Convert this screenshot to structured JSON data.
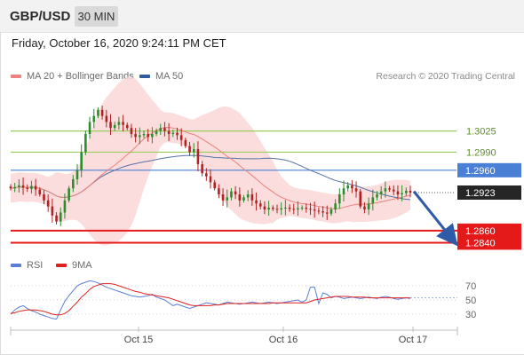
{
  "header": {
    "symbol": "GBP/USD",
    "timeframe": "30 MIN"
  },
  "datetime": "Friday, October 16, 2020 9:24:11 PM CET",
  "legend": {
    "ma20_label": "MA 20 + Bollinger Bands",
    "ma50_label": "MA 50",
    "rsi_label": "RSI",
    "rsi_ma_label": "9MA"
  },
  "research": "Research © 2020 Trading Central",
  "colors": {
    "up": "#2e8b2e",
    "down": "#b22222",
    "bb_fill": "#fbd7d7",
    "ma20": "#e9827a",
    "ma50": "#5572a6",
    "green_level": "#9acd5a",
    "blue_level": "#4a7fd6",
    "red_level": "#e41a1a",
    "current": "#222222",
    "rsi": "#5b7fd6",
    "rsi_ma": "#e02020",
    "arrow": "#2e5aa8"
  },
  "chart_data": [
    {
      "type": "candlestick",
      "title": "GBP/USD",
      "x_tick_labels": [
        "Oct 15",
        "Oct 16",
        "Oct 17"
      ],
      "levels": [
        {
          "label": "1.3025",
          "value": 1.3025,
          "kind": "resistance",
          "color": "green"
        },
        {
          "label": "1.2990",
          "value": 1.299,
          "kind": "resistance",
          "color": "green"
        },
        {
          "label": "1.2960",
          "value": 1.296,
          "kind": "pivot",
          "color": "blue"
        },
        {
          "label": "1.2923",
          "value": 1.2923,
          "kind": "last-price",
          "color": "black"
        },
        {
          "label": "1.2860",
          "value": 1.286,
          "kind": "support",
          "color": "red"
        },
        {
          "label": "1.2840",
          "value": 1.284,
          "kind": "support",
          "color": "red"
        }
      ],
      "forecast_arrow": {
        "direction": "down",
        "from": 1.2925,
        "to": 1.2848
      },
      "ylim": [
        1.2823,
        1.3095
      ],
      "closes": [
        1.293,
        1.2932,
        1.2935,
        1.2931,
        1.2929,
        1.2934,
        1.2928,
        1.292,
        1.291,
        1.29,
        1.2885,
        1.2875,
        1.289,
        1.291,
        1.293,
        1.2945,
        1.296,
        1.299,
        1.302,
        1.304,
        1.305,
        1.306,
        1.305,
        1.304,
        1.303,
        1.3035,
        1.304,
        1.3035,
        1.303,
        1.302,
        1.3015,
        1.3018,
        1.302,
        1.3015,
        1.302,
        1.3025,
        1.303,
        1.3025,
        1.302,
        1.3022,
        1.3018,
        1.301,
        1.3,
        1.299,
        1.2995,
        1.297,
        1.2955,
        1.295,
        1.294,
        1.293,
        1.292,
        1.291,
        1.2915,
        1.2925,
        1.292,
        1.291,
        1.2915,
        1.292,
        1.291,
        1.2905,
        1.29,
        1.2895,
        1.2898,
        1.2896,
        1.2895,
        1.2897,
        1.2898,
        1.2896,
        1.2895,
        1.2897,
        1.2898,
        1.2896,
        1.2895,
        1.2893,
        1.2892,
        1.289,
        1.2888,
        1.2895,
        1.2905,
        1.292,
        1.293,
        1.2935,
        1.293,
        1.2925,
        1.29,
        1.2895,
        1.2905,
        1.2915,
        1.292,
        1.2925,
        1.293,
        1.2928,
        1.2925,
        1.292,
        1.2922,
        1.2926,
        1.2923
      ],
      "series": [
        {
          "name": "MA 20 + Bollinger Bands"
        },
        {
          "name": "MA 50"
        }
      ]
    },
    {
      "type": "line",
      "title": "RSI",
      "y_tick_labels": [
        "70",
        "50",
        "30"
      ],
      "ylim": [
        15,
        85
      ],
      "series": [
        {
          "name": "RSI",
          "values": [
            30,
            36,
            40,
            42,
            38,
            35,
            33,
            30,
            28,
            26,
            24,
            23,
            36,
            48,
            56,
            63,
            70,
            73,
            75,
            77,
            76,
            74,
            71,
            68,
            66,
            64,
            62,
            60,
            58,
            56,
            55,
            54,
            55,
            56,
            58,
            54,
            52,
            50,
            46,
            42,
            44,
            42,
            40,
            38,
            40,
            42,
            44,
            46,
            45,
            44,
            43,
            45,
            47,
            46,
            45,
            44,
            45,
            46,
            47,
            46,
            45,
            46,
            47,
            46,
            45,
            46,
            47,
            48,
            49,
            50,
            47,
            50,
            68,
            68,
            45,
            60,
            58,
            53,
            55,
            54,
            52,
            53,
            54,
            53,
            52,
            53,
            54,
            53,
            52,
            54,
            55,
            54,
            52,
            51,
            52,
            53,
            52
          ]
        },
        {
          "name": "9MA",
          "values": [
            31,
            32,
            34,
            35,
            36,
            36,
            36,
            35,
            34,
            32,
            30,
            29,
            29,
            31,
            35,
            41,
            47,
            54,
            59,
            65,
            69,
            71,
            73,
            73,
            73,
            72,
            70,
            68,
            66,
            64,
            62,
            61,
            59,
            58,
            57,
            56,
            55,
            54,
            53,
            51,
            49,
            47,
            45,
            43,
            42,
            42,
            42,
            42,
            42,
            43,
            43,
            44,
            45,
            45,
            45,
            45,
            45,
            45,
            45,
            45,
            45,
            45,
            45,
            46,
            46,
            46,
            46,
            46,
            46,
            46,
            46,
            46,
            48,
            50,
            51,
            52,
            53,
            54,
            55,
            55,
            55,
            55,
            54,
            54,
            54,
            54,
            53,
            53,
            53,
            53,
            53,
            53,
            53,
            53,
            53,
            53,
            53
          ]
        }
      ]
    }
  ]
}
